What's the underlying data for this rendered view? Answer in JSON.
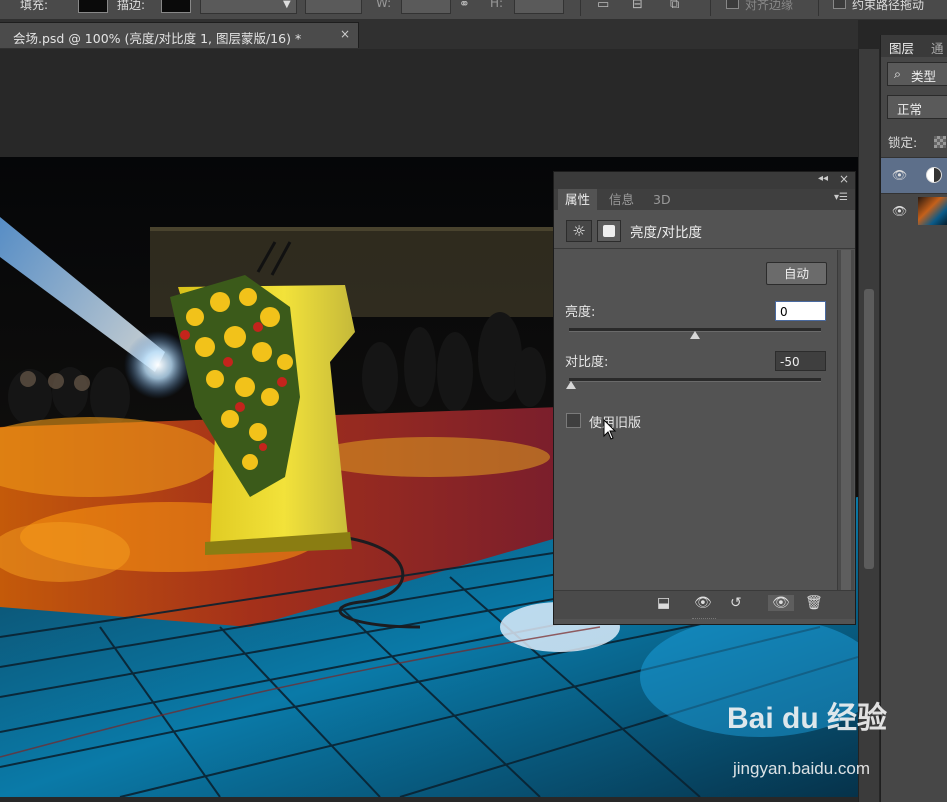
{
  "options_bar": {
    "fill_label": "填充:",
    "stroke_label": "描边:",
    "w_label": "W:",
    "h_label": "H:",
    "align_edges_label": "对齐边缘",
    "constrain_label": "约束路径拖动"
  },
  "document": {
    "tab_title": "会场.psd @ 100% (亮度/对比度 1, 图层蒙版/16) *",
    "close_glyph": "×"
  },
  "layers_panel": {
    "tabs": [
      "图层",
      "通"
    ],
    "kind_filter": "类型",
    "blend_mode": "正常",
    "lock_label": "锁定:",
    "layers": [
      {
        "type": "adjustment",
        "visible": true,
        "selected": true
      },
      {
        "type": "image",
        "visible": true,
        "selected": false
      }
    ]
  },
  "properties_panel": {
    "tabs": [
      "属性",
      "信息",
      "3D"
    ],
    "active_tab": "属性",
    "adjustment_title": "亮度/对比度",
    "auto_button": "自动",
    "brightness_label": "亮度:",
    "brightness_value": "0",
    "contrast_label": "对比度:",
    "contrast_value": "-50",
    "brightness_slider_fraction": 0.5,
    "contrast_slider_fraction": 0.0,
    "legacy_label": "使用旧版",
    "legacy_checked": false
  },
  "watermark": {
    "brand": "Bai du 经验",
    "url": "jingyan.baidu.com"
  },
  "colors": {
    "app_bg": "#262626",
    "panel_bg": "#535353",
    "selected_layer": "#5d6f8a"
  }
}
